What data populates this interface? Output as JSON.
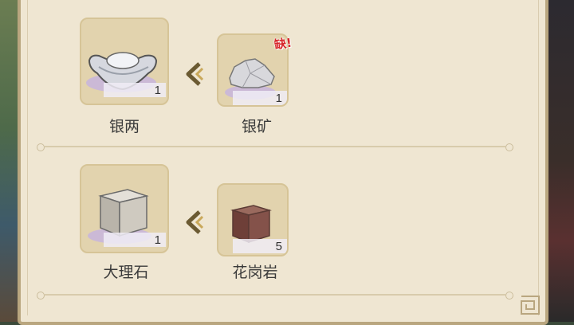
{
  "recipes": [
    {
      "output": {
        "name": "银两",
        "count": "1",
        "icon": "silver-ingot-icon"
      },
      "input": {
        "name": "银矿",
        "count": "1",
        "icon": "silver-ore-icon",
        "badge": "缺!"
      }
    },
    {
      "output": {
        "name": "大理石",
        "count": "1",
        "icon": "marble-block-icon"
      },
      "input": {
        "name": "花岗岩",
        "count": "5",
        "icon": "granite-block-icon"
      }
    }
  ],
  "colors": {
    "panel": "#efe6d2",
    "slot": "#e2d3ae",
    "badge": "#d7262a",
    "arrow": "#6b5a32"
  }
}
